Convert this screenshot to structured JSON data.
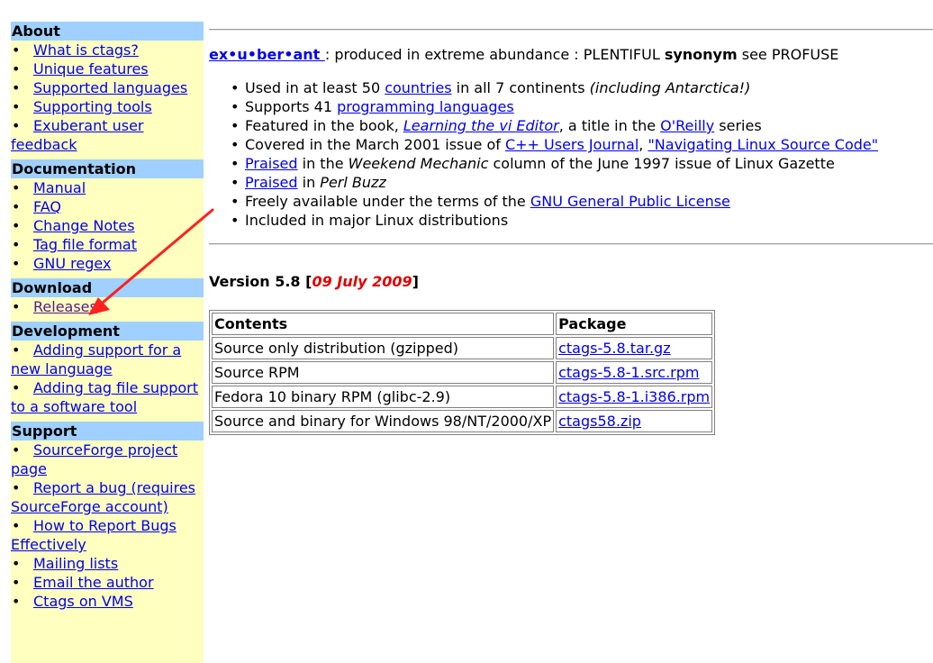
{
  "sidebar": {
    "about": {
      "heading": "About",
      "items": [
        "What is ctags?",
        "Unique features",
        "Supported languages",
        "Supporting tools",
        "Exuberant user feedback"
      ]
    },
    "documentation": {
      "heading": "Documentation",
      "items": [
        "Manual",
        "FAQ",
        "Change Notes",
        "Tag file format",
        "GNU regex"
      ]
    },
    "download": {
      "heading": "Download",
      "items": [
        "Releases"
      ]
    },
    "development": {
      "heading": "Development",
      "items": [
        "Adding support for a new language",
        "Adding tag file support to a software tool"
      ]
    },
    "support": {
      "heading": "Support",
      "items": [
        "SourceForge project page",
        "Report a bug (requires SourceForge account)",
        "How to Report Bugs Effectively",
        "Mailing lists",
        "Email the author",
        "Ctags on VMS"
      ]
    }
  },
  "definition": {
    "word": "ex•u•ber•ant ",
    "text": ": produced in extreme abundance : PLENTIFUL ",
    "synonym_label": "synonym",
    "synonym_text": " see PROFUSE"
  },
  "features": {
    "f1_a": "Used in at least 50 ",
    "f1_link": "countries",
    "f1_b": " in all 7 continents ",
    "f1_c": "(including Antarctica!)",
    "f2_a": "Supports 41 ",
    "f2_link": "programming languages",
    "f3_a": "Featured in the book, ",
    "f3_link1": "Learning the vi Editor",
    "f3_b": ", a title in the ",
    "f3_link2": "O'Reilly",
    "f3_c": " series",
    "f4_a": "Covered in the March 2001 issue of ",
    "f4_link1": "C++ Users Journal",
    "f4_b": ", ",
    "f4_link2": "\"Navigating Linux Source Code\"",
    "f5_link": "Praised",
    "f5_a": " in the ",
    "f5_b": "Weekend Mechanic",
    "f5_c": " column of the June 1997 issue of Linux Gazette",
    "f6_link": "Praised",
    "f6_a": " in ",
    "f6_b": "Perl Buzz",
    "f7_a": "Freely available under the terms of the ",
    "f7_link": "GNU General Public License",
    "f8_a": "Included in major Linux distributions"
  },
  "version": {
    "label": "Version 5.8 [",
    "date": "09 July 2009",
    "close": "]"
  },
  "packages": {
    "headers": [
      "Contents",
      "Package"
    ],
    "rows": [
      [
        "Source only distribution (gzipped)",
        "ctags-5.8.tar.gz"
      ],
      [
        "Source RPM",
        "ctags-5.8-1.src.rpm"
      ],
      [
        "Fedora 10 binary RPM (glibc-2.9)",
        "ctags-5.8-1.i386.rpm"
      ],
      [
        "Source and binary for Windows 98/NT/2000/XP",
        "ctags58.zip"
      ]
    ]
  },
  "colors": {
    "sidebar_bg": "#ffffc0",
    "heading_bg": "#a0d0ff",
    "link": "#0000ee",
    "visited": "#551a8b",
    "date": "#e00000",
    "annotation_arrow": "#ff2020"
  }
}
